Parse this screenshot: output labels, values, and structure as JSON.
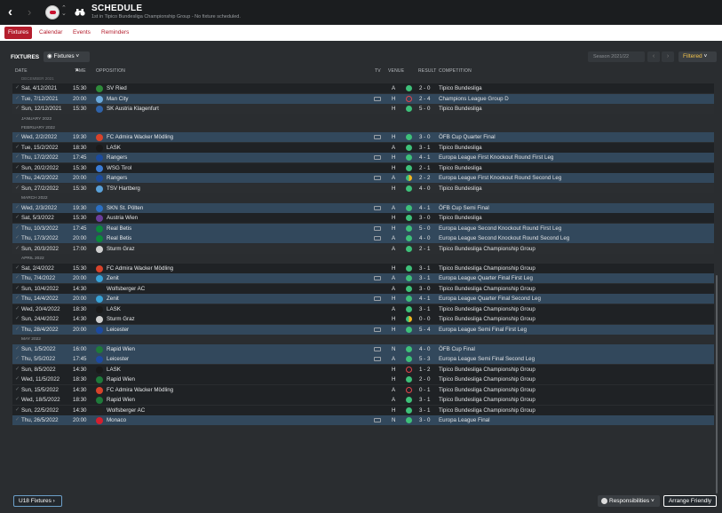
{
  "header": {
    "title": "SCHEDULE",
    "subtitle": "1st in Tipico Bundesliga Championship Group - No fixture scheduled."
  },
  "tabs": [
    {
      "label": "Fixtures",
      "active": true
    },
    {
      "label": "Calendar",
      "active": false
    },
    {
      "label": "Events",
      "active": false
    },
    {
      "label": "Reminders",
      "active": false
    }
  ],
  "toolbar": {
    "section_label": "FIXTURES",
    "view_dropdown": "Fixtures",
    "season": "Season 2021/22",
    "filter_label": "Filtered"
  },
  "columns": {
    "date": "DATE",
    "time": "TIME",
    "opposition": "OPPOSITION",
    "tv": "TV",
    "venue": "VENUE",
    "result": "RESULT",
    "competition": "COMPETITION"
  },
  "top_month_label": "DECEMBER 2021",
  "colors": {
    "accent_red": "#b41e2d",
    "win_green": "#3ec079",
    "loss_red": "#e2454d",
    "draw_yellow": "#f2b820",
    "highlight_row": "#32485c"
  },
  "rows": [
    {
      "type": "fixture",
      "date": "Sat, 4/12/2021",
      "time": "15:30",
      "opp": "SV Ried",
      "tv": false,
      "venue": "A",
      "res": "win",
      "score": "2 - 0",
      "comp": "Tipico Bundesliga",
      "crest": "#2e8b3a",
      "bg": "r-dark"
    },
    {
      "type": "fixture",
      "date": "Tue, 7/12/2021",
      "time": "20:00",
      "opp": "Man City",
      "tv": true,
      "venue": "H",
      "res": "loss",
      "score": "2 - 4",
      "comp": "Champions League Group D",
      "crest": "#6cabdd",
      "bg": "r-blue"
    },
    {
      "type": "fixture",
      "date": "Sun, 12/12/2021",
      "time": "15:30",
      "opp": "SK Austria Klagenfurt",
      "tv": false,
      "venue": "H",
      "res": "win",
      "score": "5 - 0",
      "comp": "Tipico Bundesliga",
      "crest": "#2f62a8",
      "bg": "r-mid"
    },
    {
      "type": "month",
      "label": "JANUARY 2022"
    },
    {
      "type": "month",
      "label": "FEBRUARY 2022"
    },
    {
      "type": "fixture",
      "date": "Wed, 2/2/2022",
      "time": "19:30",
      "opp": "FC Admira Wacker Mödling",
      "tv": true,
      "venue": "H",
      "res": "win",
      "score": "3 - 0",
      "comp": "ÖFB Cup Quarter Final",
      "crest": "#d8432b",
      "bg": "r-blue"
    },
    {
      "type": "fixture",
      "date": "Tue, 15/2/2022",
      "time": "18:30",
      "opp": "LASK",
      "tv": false,
      "venue": "A",
      "res": "win",
      "score": "3 - 1",
      "comp": "Tipico Bundesliga",
      "crest": "#1a1a1a",
      "bg": "r-dark"
    },
    {
      "type": "fixture",
      "date": "Thu, 17/2/2022",
      "time": "17:45",
      "opp": "Rangers",
      "tv": true,
      "venue": "H",
      "res": "win",
      "score": "4 - 1",
      "comp": "Europa League First Knockout Round First Leg",
      "crest": "#1b4a9c",
      "bg": "r-blue"
    },
    {
      "type": "fixture",
      "date": "Sun, 20/2/2022",
      "time": "15:30",
      "opp": "WSG Tirol",
      "tv": false,
      "venue": "H",
      "res": "win",
      "score": "2 - 1",
      "comp": "Tipico Bundesliga",
      "crest": "#3a7bd5",
      "bg": "r-dark"
    },
    {
      "type": "fixture",
      "date": "Thu, 24/2/2022",
      "time": "20:00",
      "opp": "Rangers",
      "tv": true,
      "venue": "A",
      "res": "draw",
      "score": "2 - 2",
      "comp": "Europa League First Knockout Round Second Leg",
      "crest": "#1b4a9c",
      "bg": "r-blue"
    },
    {
      "type": "fixture",
      "date": "Sun, 27/2/2022",
      "time": "15:30",
      "opp": "TSV Hartberg",
      "tv": false,
      "venue": "H",
      "res": "win",
      "score": "4 - 0",
      "comp": "Tipico Bundesliga",
      "crest": "#5aa0d8",
      "bg": "r-mid"
    },
    {
      "type": "month",
      "label": "MARCH 2022"
    },
    {
      "type": "fixture",
      "date": "Wed, 2/3/2022",
      "time": "19:30",
      "opp": "SKN St. Pölten",
      "tv": true,
      "venue": "A",
      "res": "win",
      "score": "4 - 1",
      "comp": "ÖFB Cup Semi Final",
      "crest": "#2b6fc4",
      "bg": "r-blue"
    },
    {
      "type": "fixture",
      "date": "Sat, 5/3/2022",
      "time": "15:30",
      "opp": "Austria Wien",
      "tv": false,
      "venue": "H",
      "res": "win",
      "score": "3 - 0",
      "comp": "Tipico Bundesliga",
      "crest": "#6a3d9a",
      "bg": "r-dark"
    },
    {
      "type": "fixture",
      "date": "Thu, 10/3/2022",
      "time": "17:45",
      "opp": "Real Betis",
      "tv": true,
      "venue": "H",
      "res": "win",
      "score": "5 - 0",
      "comp": "Europa League Second Knockout Round First Leg",
      "crest": "#0b8a3a",
      "bg": "r-blue"
    },
    {
      "type": "fixture",
      "date": "Thu, 17/3/2022",
      "time": "20:00",
      "opp": "Real Betis",
      "tv": true,
      "venue": "A",
      "res": "win",
      "score": "4 - 0",
      "comp": "Europa League Second Knockout Round Second Leg",
      "crest": "#0b8a3a",
      "bg": "r-blue"
    },
    {
      "type": "fixture",
      "date": "Sun, 20/3/2022",
      "time": "17:00",
      "opp": "Sturm Graz",
      "tv": false,
      "venue": "A",
      "res": "win",
      "score": "2 - 1",
      "comp": "Tipico Bundesliga Championship Group",
      "crest": "#cfcfcf",
      "bg": "r-mid"
    },
    {
      "type": "month",
      "label": "APRIL 2022"
    },
    {
      "type": "fixture",
      "date": "Sat, 2/4/2022",
      "time": "15:30",
      "opp": "FC Admira Wacker Mödling",
      "tv": false,
      "venue": "H",
      "res": "win",
      "score": "3 - 1",
      "comp": "Tipico Bundesliga Championship Group",
      "crest": "#d8432b",
      "bg": "r-dark"
    },
    {
      "type": "fixture",
      "date": "Thu, 7/4/2022",
      "time": "20:00",
      "opp": "Zenit",
      "tv": true,
      "venue": "A",
      "res": "win",
      "score": "3 - 1",
      "comp": "Europa League Quarter Final First Leg",
      "crest": "#38a3d8",
      "bg": "r-blue"
    },
    {
      "type": "fixture",
      "date": "Sun, 10/4/2022",
      "time": "14:30",
      "opp": "Wolfsberger AC",
      "tv": false,
      "venue": "A",
      "res": "win",
      "score": "3 - 0",
      "comp": "Tipico Bundesliga Championship Group",
      "crest": "#222222",
      "bg": "r-dark"
    },
    {
      "type": "fixture",
      "date": "Thu, 14/4/2022",
      "time": "20:00",
      "opp": "Zenit",
      "tv": true,
      "venue": "H",
      "res": "win",
      "score": "4 - 1",
      "comp": "Europa League Quarter Final Second Leg",
      "crest": "#38a3d8",
      "bg": "r-blue"
    },
    {
      "type": "fixture",
      "date": "Wed, 20/4/2022",
      "time": "18:30",
      "opp": "LASK",
      "tv": false,
      "venue": "A",
      "res": "win",
      "score": "3 - 1",
      "comp": "Tipico Bundesliga Championship Group",
      "crest": "#1a1a1a",
      "bg": "r-dark"
    },
    {
      "type": "fixture",
      "date": "Sun, 24/4/2022",
      "time": "14:30",
      "opp": "Sturm Graz",
      "tv": false,
      "venue": "H",
      "res": "draw",
      "score": "0 - 0",
      "comp": "Tipico Bundesliga Championship Group",
      "crest": "#cfcfcf",
      "bg": "r-dark"
    },
    {
      "type": "fixture",
      "date": "Thu, 28/4/2022",
      "time": "20:00",
      "opp": "Leicester",
      "tv": true,
      "venue": "H",
      "res": "win",
      "score": "5 - 4",
      "comp": "Europa League Semi Final First Leg",
      "crest": "#1d4aa0",
      "bg": "r-blue"
    },
    {
      "type": "month",
      "label": "MAY 2022"
    },
    {
      "type": "fixture",
      "date": "Sun, 1/5/2022",
      "time": "16:00",
      "opp": "Rapid Wien",
      "tv": true,
      "venue": "N",
      "res": "win",
      "score": "4 - 0",
      "comp": "ÖFB Cup Final",
      "crest": "#1f7a3a",
      "bg": "r-blue"
    },
    {
      "type": "fixture",
      "date": "Thu, 5/5/2022",
      "time": "17:45",
      "opp": "Leicester",
      "tv": true,
      "venue": "A",
      "res": "win",
      "score": "5 - 3",
      "comp": "Europa League Semi Final Second Leg",
      "crest": "#1d4aa0",
      "bg": "r-blue"
    },
    {
      "type": "fixture",
      "date": "Sun, 8/5/2022",
      "time": "14:30",
      "opp": "LASK",
      "tv": false,
      "venue": "H",
      "res": "loss",
      "score": "1 - 2",
      "comp": "Tipico Bundesliga Championship Group",
      "crest": "#1a1a1a",
      "bg": "r-dark"
    },
    {
      "type": "fixture",
      "date": "Wed, 11/5/2022",
      "time": "18:30",
      "opp": "Rapid Wien",
      "tv": false,
      "venue": "H",
      "res": "win",
      "score": "2 - 0",
      "comp": "Tipico Bundesliga Championship Group",
      "crest": "#1f7a3a",
      "bg": "r-dark"
    },
    {
      "type": "fixture",
      "date": "Sun, 15/5/2022",
      "time": "14:30",
      "opp": "FC Admira Wacker Mödling",
      "tv": false,
      "venue": "A",
      "res": "loss",
      "score": "0 - 1",
      "comp": "Tipico Bundesliga Championship Group",
      "crest": "#d8432b",
      "bg": "r-dark"
    },
    {
      "type": "fixture",
      "date": "Wed, 18/5/2022",
      "time": "18:30",
      "opp": "Rapid Wien",
      "tv": false,
      "venue": "A",
      "res": "win",
      "score": "3 - 1",
      "comp": "Tipico Bundesliga Championship Group",
      "crest": "#1f7a3a",
      "bg": "r-dark"
    },
    {
      "type": "fixture",
      "date": "Sun, 22/5/2022",
      "time": "14:30",
      "opp": "Wolfsberger AC",
      "tv": false,
      "venue": "H",
      "res": "win",
      "score": "3 - 1",
      "comp": "Tipico Bundesliga Championship Group",
      "crest": "#222222",
      "bg": "r-dark"
    },
    {
      "type": "fixture",
      "date": "Thu, 26/5/2022",
      "time": "20:00",
      "opp": "Monaco",
      "tv": true,
      "venue": "N",
      "res": "win",
      "score": "3 - 0",
      "comp": "Europa League Final",
      "crest": "#d41f2e",
      "bg": "r-blue"
    }
  ],
  "footer": {
    "u18_button": "U18 Fixtures",
    "responsibilities": "Responsibilities",
    "arrange_friendly": "Arrange Friendly"
  }
}
